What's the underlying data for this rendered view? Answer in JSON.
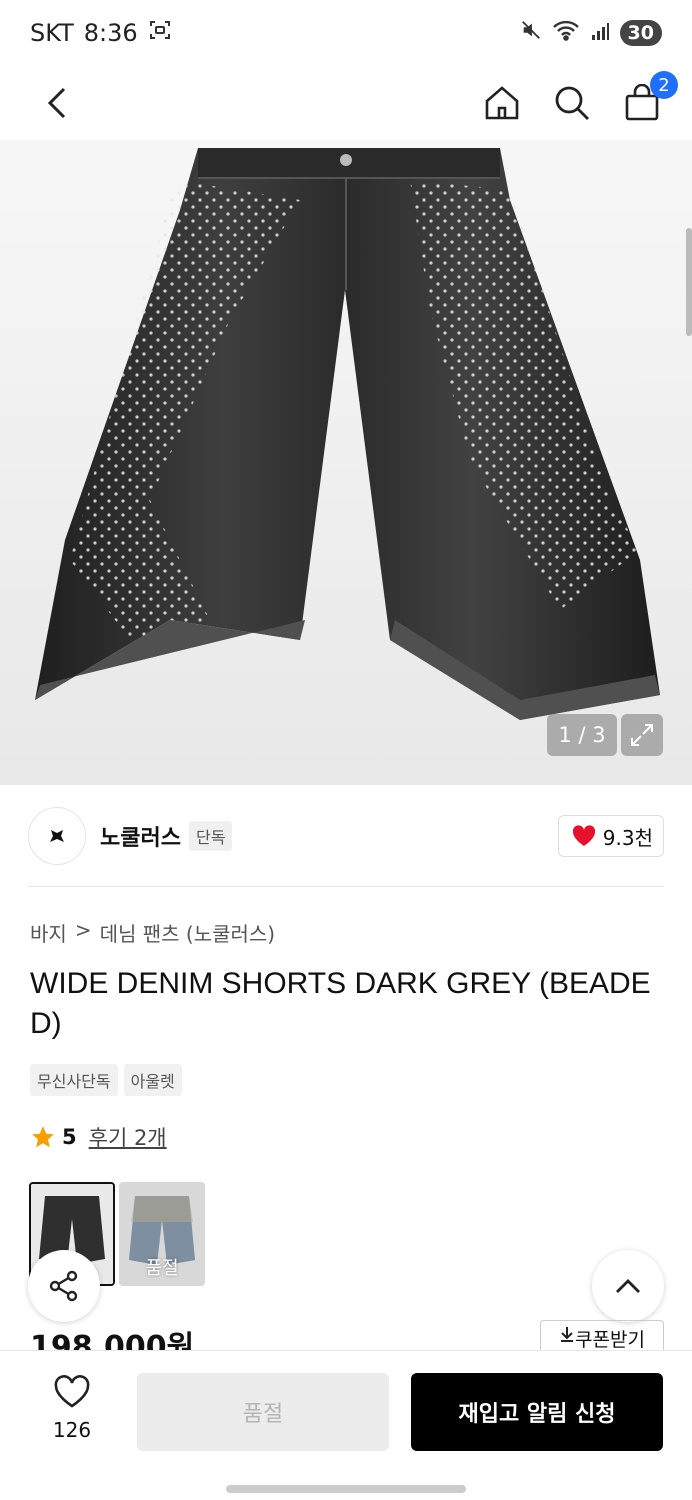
{
  "status_bar": {
    "carrier": "SKT",
    "time": "8:36",
    "battery": "30",
    "icons": [
      "screenshot-icon",
      "mute-icon",
      "wifi-icon",
      "signal-icon"
    ]
  },
  "nav": {
    "cart_count": "2",
    "icons": [
      "back-icon",
      "home-icon",
      "search-icon",
      "cart-icon"
    ]
  },
  "gallery": {
    "counter": "1 / 3"
  },
  "brand": {
    "name": "노쿨러스",
    "tag": "단독",
    "likes": "9.3천"
  },
  "breadcrumb": {
    "category": "바지",
    "separator": ">",
    "subcategory": "데님 팬츠 (노쿨러스)"
  },
  "product": {
    "title": "WIDE DENIM SHORTS DARK GREY (BEADED)",
    "tags": [
      "무신사단독",
      "아울렛"
    ],
    "rating": "5",
    "reviews": "후기 2개",
    "variant_sold_label": "품절",
    "price": "198,000원",
    "coupon": "쿠폰받기"
  },
  "bottom_bar": {
    "wish_count": "126",
    "soldout_label": "품절",
    "restock_label": "재입고 알림 신청"
  },
  "colors": {
    "accent_blue": "#1f6fff",
    "heart_red": "#e8112d",
    "star_orange": "#f5a000",
    "primary_black": "#000000"
  }
}
